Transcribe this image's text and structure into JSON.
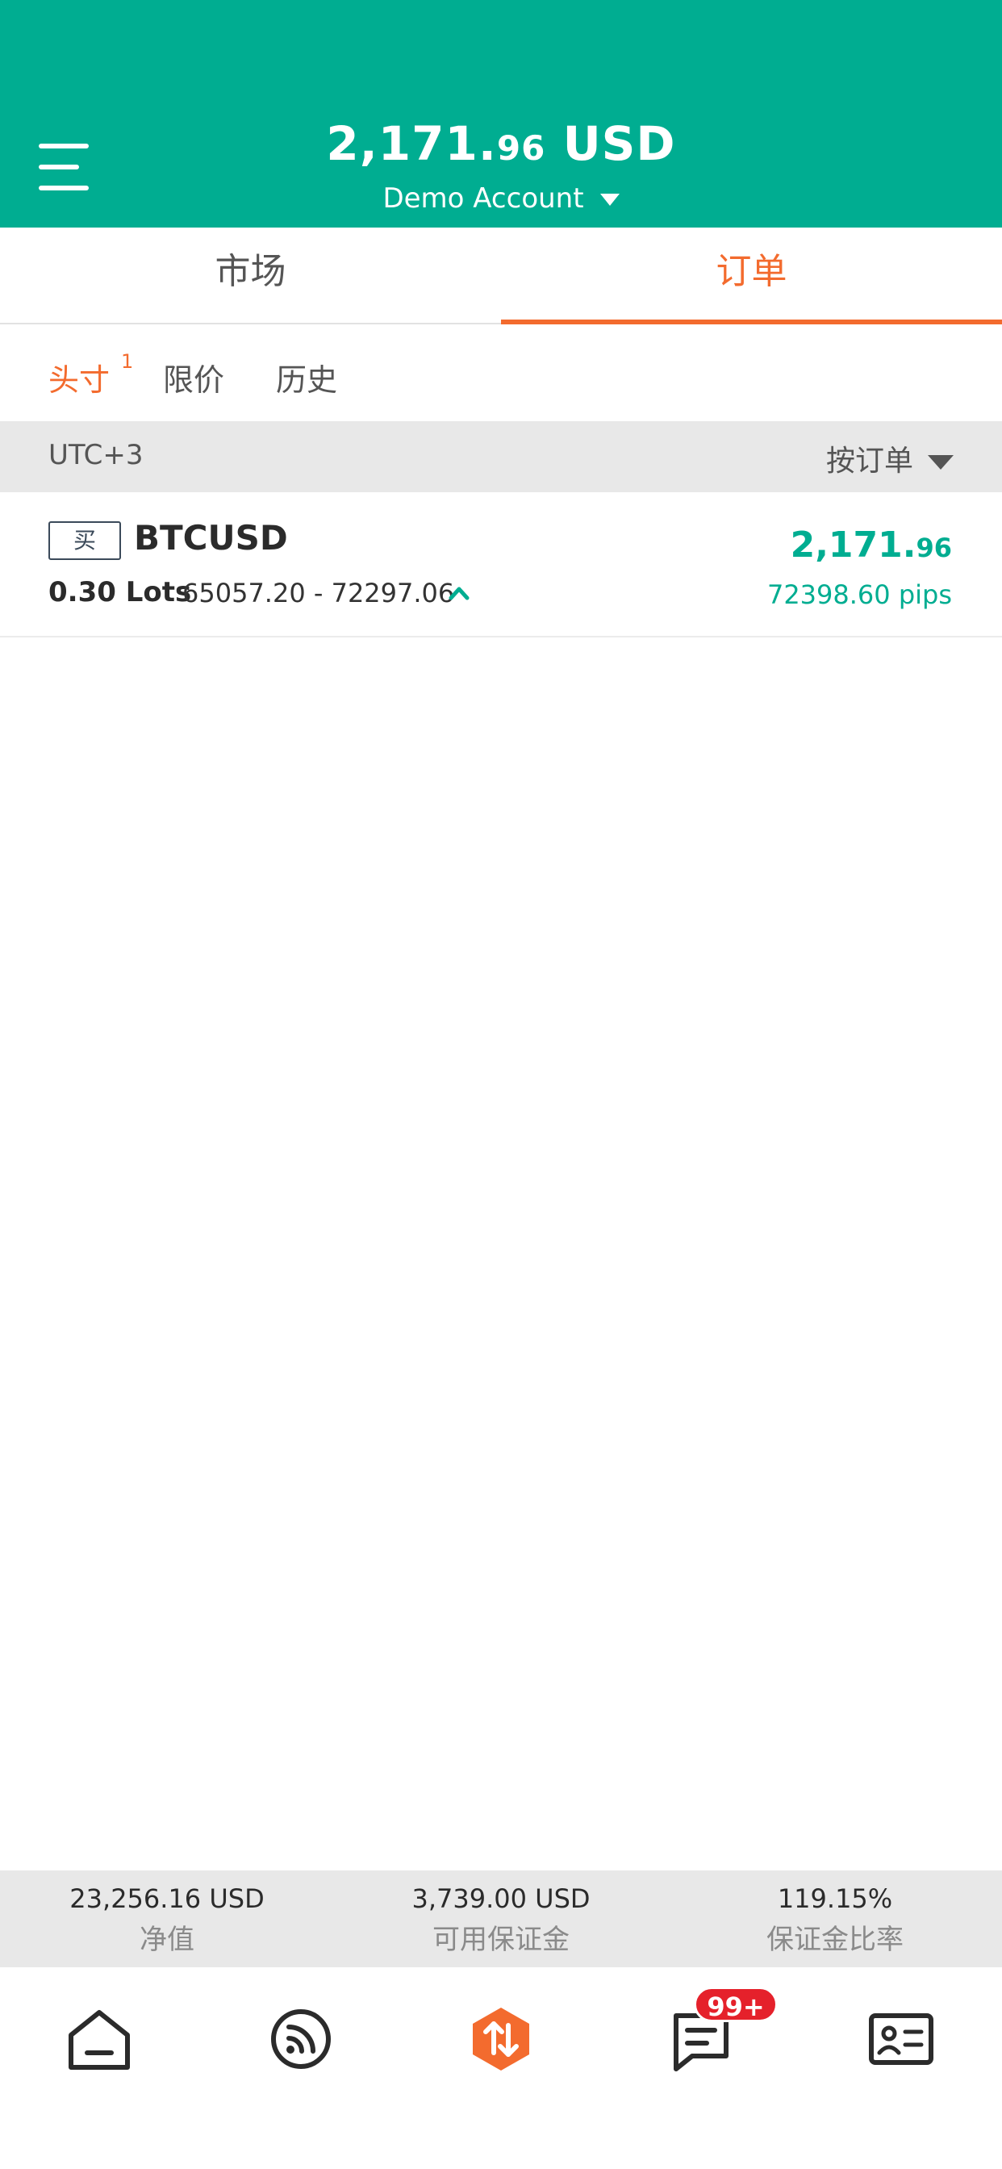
{
  "header": {
    "balance_int": "2,171.",
    "balance_dec": "96",
    "balance_currency": "USD",
    "account_label": "Demo Account"
  },
  "main_tabs": [
    {
      "label": "市场",
      "active": false
    },
    {
      "label": "订单",
      "active": true
    }
  ],
  "sub_tabs": [
    {
      "label": "头寸",
      "active": true,
      "count": "1"
    },
    {
      "label": "限价",
      "active": false
    },
    {
      "label": "历史",
      "active": false
    }
  ],
  "group_bar": {
    "timezone": "UTC+3",
    "sort_label": "按订单"
  },
  "positions": [
    {
      "side": "买",
      "symbol": "BTCUSD",
      "lots": "0.30 Lots",
      "range": "65057.20 - 72297.06",
      "pl_int": "2,171.",
      "pl_dec": "96",
      "pips": "72398.60 pips"
    }
  ],
  "summary": [
    {
      "value": "23,256.16 USD",
      "label": "净值"
    },
    {
      "value": "3,739.00 USD",
      "label": "可用保证金"
    },
    {
      "value": "119.15%",
      "label": "保证金比率"
    }
  ],
  "bottom_nav": {
    "items": [
      "home-icon",
      "feed-icon",
      "trade-icon",
      "messages-icon",
      "profile-card-icon"
    ],
    "messages_badge": "99+"
  },
  "colors": {
    "brand_green": "#00ad91",
    "accent_orange": "#f36b2e",
    "badge_red": "#e5212b"
  }
}
